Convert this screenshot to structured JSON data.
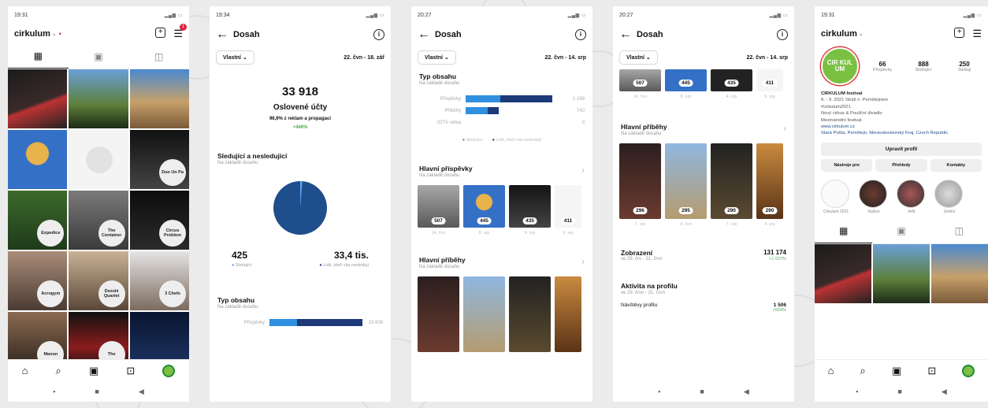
{
  "phone1": {
    "status_time": "19:31",
    "status_right": "",
    "username": "cirkulum",
    "badge_count": "1",
    "tiles": [
      "",
      "",
      "",
      "",
      "",
      "Duo Un Pa",
      "Expedice",
      "The Container",
      "Circus Problem",
      "Acrogym",
      "Dezolé Quartet",
      "3 Chefs",
      "Manon",
      "The",
      ""
    ]
  },
  "phone2": {
    "status_time": "19:34",
    "nav_title": "Dosah",
    "filter_label": "Vlastní",
    "date_range": "22. čvn - 18. zář",
    "big_number": "33 918",
    "big_label": "Oslovené účty",
    "ads_note": "96,9% z reklam a propagací",
    "delta_pct": "+446%",
    "section1_title": "Sledující a nesledující",
    "section1_sub": "Na základě dosahu",
    "followers": "425",
    "followers_label": "Sledující",
    "nonfollowers": "33,4 tis.",
    "nonfollowers_label": "Lidé, kteří vás nesledují",
    "section2_title": "Typ obsahu",
    "section2_sub": "Na základě dosahu",
    "posts_label": "Příspěvky",
    "posts_value": "33 838"
  },
  "phone3": {
    "status_time": "20:27",
    "nav_title": "Dosah",
    "filter_label": "Vlastní",
    "date_range": "22. čvn - 14. srp",
    "section1_title": "Typ obsahu",
    "section1_sub": "Na základě dosahu",
    "rows": [
      {
        "name": "Příspěvky",
        "value": "1 189"
      },
      {
        "name": "Příběhy",
        "value": "740"
      },
      {
        "name": "IGTV videa",
        "value": "0"
      }
    ],
    "legend_followers": "Sledující",
    "legend_non": "Lidé, kteří vás nesledují",
    "section2_title": "Hlavní příspěvky",
    "section2_sub": "Na základě dosahu",
    "post_counts": [
      "507",
      "445",
      "435",
      "411"
    ],
    "post_dates": [
      "14. čvn",
      "8. srp",
      "4. srp",
      "9. srp"
    ],
    "section3_title": "Hlavní příběhy",
    "section3_sub": "Na základě dosahu"
  },
  "phone4": {
    "status_time": "20:27",
    "nav_title": "Dosah",
    "filter_label": "Vlastní",
    "date_range": "22. čvn - 14. srp",
    "post_counts": [
      "507",
      "445",
      "435",
      "411"
    ],
    "post_dates": [
      "14. čvn",
      "8. srp",
      "4. srp",
      "9. srp"
    ],
    "section1_title": "Hlavní příběhy",
    "section1_sub": "Na základě dosahu",
    "story_counts": [
      "296",
      "295",
      "290",
      "290"
    ],
    "story_dates": [
      "7. srp",
      "4. čvn",
      "7. srp",
      "4. srp"
    ],
    "impressions_title": "Zobrazení",
    "impressions_sub": "ve 29. črv - 31. črvn",
    "impressions_value": "131 174",
    "impressions_delta": "+1 027%",
    "activity_title": "Aktivita na profilu",
    "activity_sub": "ve 29. črvn - 31. črvn",
    "visits_label": "Návštěvy profilu",
    "visits_value": "1 506",
    "visits_delta": "+554%"
  },
  "phone5": {
    "status_time": "19:31",
    "username": "cirkulum",
    "logo_text": "CIR KUL UM",
    "posts_n": "66",
    "posts_t": "Příspěvky",
    "followers_n": "888",
    "followers_t": "Sledující",
    "following_n": "250",
    "following_t": "Sleduji",
    "bio": [
      "CIRKULUM festival",
      "8. - 9. 2021 Stráž n. Pernštejnem",
      "#cirkulum2021",
      "Nový cirkus & Pouliční divadlo",
      "Mezinárodní festival",
      "www.cirkulum.cz",
      "Stará Pošta, Pernštejn, Moravskoslezský Kraj, Czech Republic"
    ],
    "edit_btn": "Upravit profil",
    "btn1": "Nástroje pro",
    "btn2": "Přehledy",
    "btn3": "Kontakty",
    "highlights": [
      "Cirkulum 2021",
      "Naživo",
      "Artit",
      "Umění"
    ]
  }
}
